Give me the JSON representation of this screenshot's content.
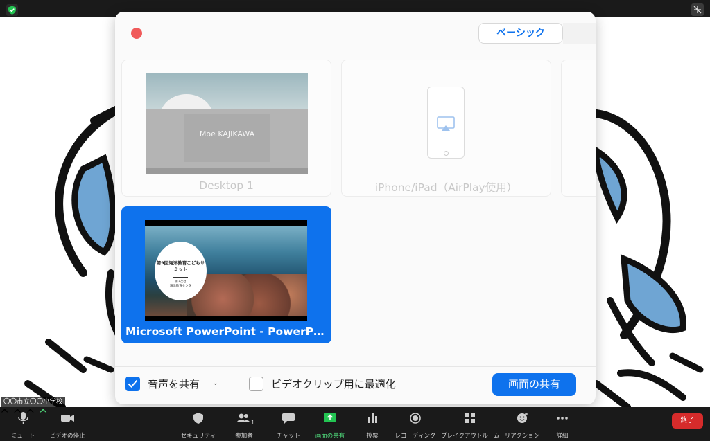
{
  "dialog": {
    "tab_label": "ベーシック",
    "tiles": [
      {
        "label": "Desktop 1",
        "preview_name": "Moe KAJIKAWA"
      },
      {
        "label": "iPhone/iPad（AirPlay使用）"
      },
      {
        "label": "Microsoft PowerPoint - PowerPoint...",
        "slide_title": "第9回海洋教育こどもサミット",
        "slide_sub1": "第3次ゼ",
        "slide_sub2": "海洋教育センタ"
      }
    ],
    "share_audio_label": "音声を共有",
    "optimize_label": "ビデオクリップ用に最適化",
    "share_button": "画面の共有"
  },
  "participant_name": "〇〇市立〇〇小学校",
  "toolbar": {
    "mute": "ミュート",
    "stop_video": "ビデオの停止",
    "security": "セキュリティ",
    "participants": "参加者",
    "participants_count": "1",
    "chat": "チャット",
    "share_screen": "画面の共有",
    "polls": "投票",
    "recording": "レコーディング",
    "breakout": "ブレイクアウトルーム",
    "reactions": "リアクション",
    "more": "詳細",
    "end": "終了"
  },
  "colors": {
    "accent": "#0e72ed",
    "share_green": "#23c552",
    "end_red": "#d62b2b",
    "close_red": "#f05a5a"
  }
}
